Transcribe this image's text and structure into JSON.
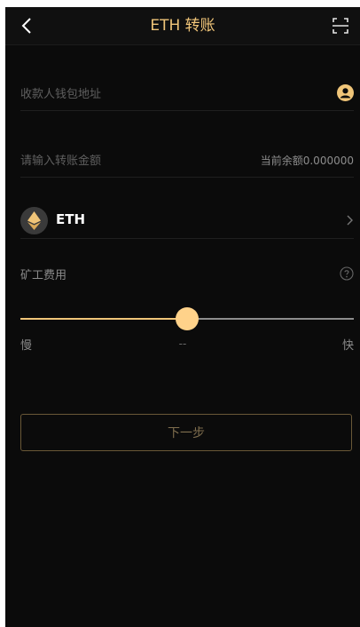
{
  "header": {
    "title": "ETH 转账",
    "back_icon": "chevron-left-icon",
    "scan_icon": "scan-frame-icon"
  },
  "form": {
    "address_placeholder": "收款人钱包地址",
    "contact_icon": "contact-person-icon",
    "amount_placeholder": "请输入转账金额",
    "balance_text": "当前余额0.000000"
  },
  "token": {
    "name": "ETH",
    "logo_icon": "ethereum-icon",
    "arrow_icon": "chevron-right-icon"
  },
  "fee": {
    "label": "矿工费用",
    "help_icon": "question-circle-icon",
    "slow_label": "慢",
    "fast_label": "快",
    "value": "--",
    "slider_level": 0.5
  },
  "actions": {
    "next_label": "下一步"
  },
  "colors": {
    "accent": "#f0c579",
    "background": "#0b0b0b",
    "thumb": "#ffd28a"
  }
}
